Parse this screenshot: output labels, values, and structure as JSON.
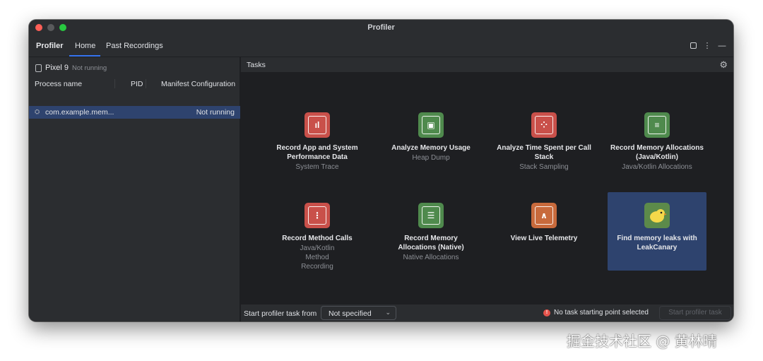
{
  "window": {
    "title": "Profiler"
  },
  "tabs": {
    "profiler": "Profiler",
    "home": "Home",
    "past_recordings": "Past Recordings"
  },
  "device": {
    "name": "Pixel 9",
    "status": "Not running"
  },
  "process_table": {
    "headers": [
      "Process name",
      "PID",
      "Manifest Configuration"
    ],
    "rows": [
      {
        "name": "com.example.mem...",
        "pid": "",
        "status": "Not running"
      }
    ]
  },
  "tasks": {
    "title": "Tasks",
    "items": [
      {
        "name": "Record App and System Performance Data",
        "sub": "System Trace",
        "icon": "chip-trace-icon",
        "color": "#c9504a"
      },
      {
        "name": "Analyze Memory Usage",
        "sub": "Heap Dump",
        "icon": "memory-chip-icon",
        "color": "#4f8a4d"
      },
      {
        "name": "Analyze Time Spent per Call Stack",
        "sub": "Stack Sampling",
        "icon": "call-stack-icon",
        "color": "#c9504a"
      },
      {
        "name": "Record Memory Allocations (Java/Kotlin)",
        "sub": "Java/Kotlin Allocations",
        "icon": "memory-alloc-icon",
        "color": "#4f8a4d"
      },
      {
        "name": "Record Method Calls",
        "sub": "Java/Kotlin Method Recording",
        "icon": "method-calls-icon",
        "color": "#c9504a"
      },
      {
        "name": "Record Memory Allocations (Native)",
        "sub": "Native Allocations",
        "icon": "native-alloc-icon",
        "color": "#4f8a4d"
      },
      {
        "name": "View Live Telemetry",
        "sub": "",
        "icon": "telemetry-icon",
        "color": "#c86a3c"
      },
      {
        "name": "Find memory leaks with LeakCanary",
        "sub": "",
        "icon": "leakcanary-icon",
        "color": "#5c8a4a"
      }
    ]
  },
  "bottom": {
    "start_label": "Start profiler task from",
    "select_value": "Not specified",
    "warning": "No task starting point selected",
    "start_button": "Start profiler task"
  },
  "watermark": "掘金技术社区 @ 黄林晴"
}
